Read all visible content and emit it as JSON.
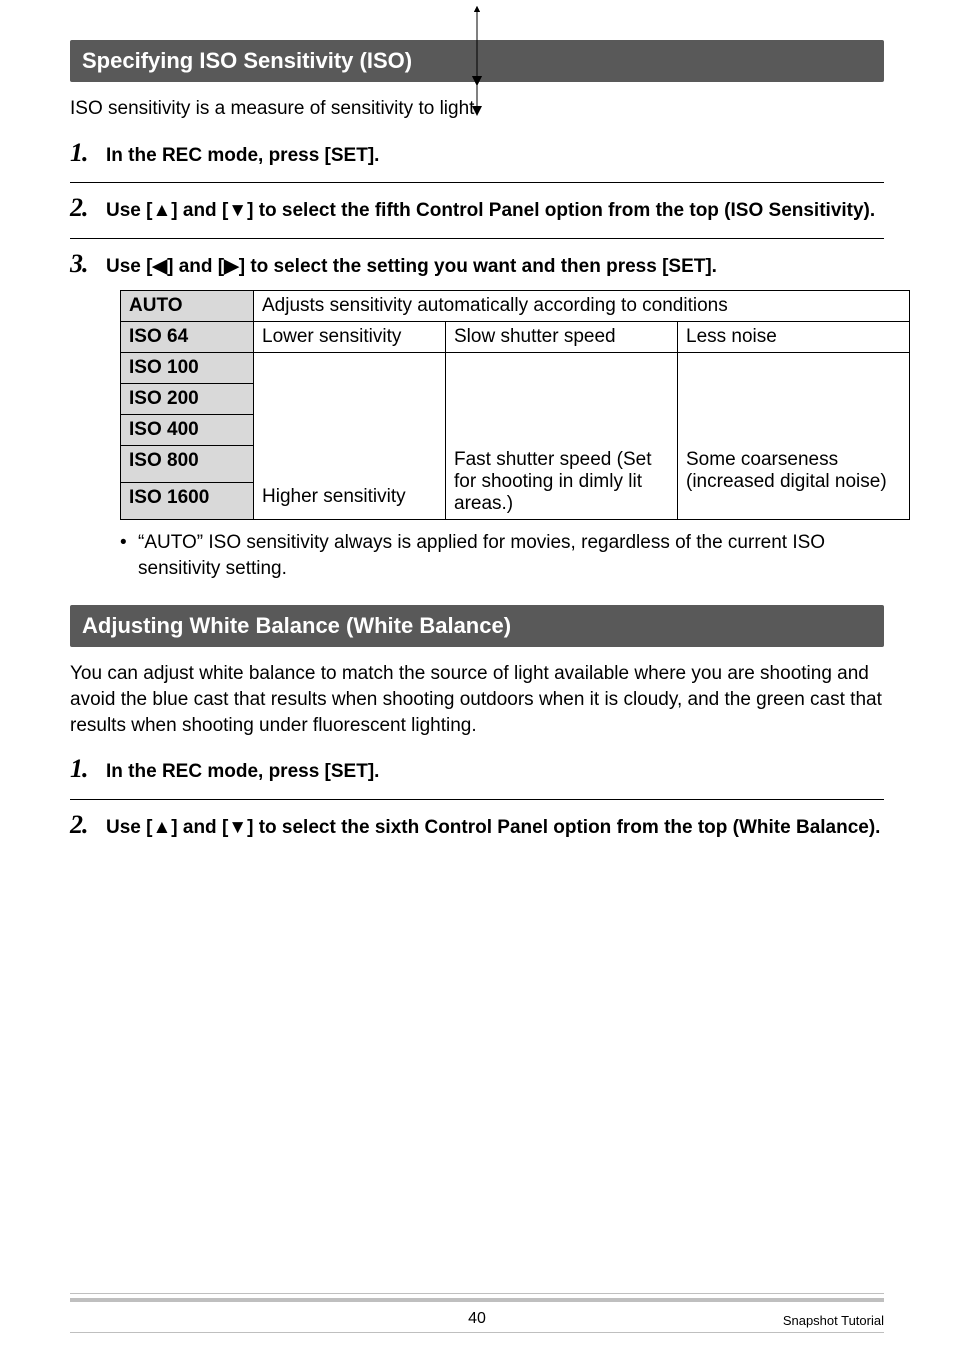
{
  "section1": {
    "title": "Specifying ISO Sensitivity (ISO)",
    "intro": "ISO sensitivity is a measure of sensitivity to light.",
    "steps": {
      "s1": {
        "num": "1.",
        "text": "In the REC mode, press [SET]."
      },
      "s2": {
        "num": "2.",
        "prefix": "Use [",
        "mid": "] and [",
        "suffix": "] to select the fifth Control Panel option from the top (ISO Sensitivity)."
      },
      "s3": {
        "num": "3.",
        "prefix": "Use [",
        "mid": "] and [",
        "suffix": "] to select the setting you want and then press [SET]."
      }
    },
    "table": {
      "rows": [
        "AUTO",
        "ISO 64",
        "ISO 100",
        "ISO 200",
        "ISO 400",
        "ISO 800",
        "ISO 1600"
      ],
      "auto_text": "Adjusts sensitivity automatically according to conditions",
      "col1_top": "Lower sensitivity",
      "col1_bot": "Higher sensitivity",
      "col2_top": "Slow shutter speed",
      "col2_bot": "Fast shutter speed (Set for shooting in dimly lit areas.)",
      "col3_top": "Less noise",
      "col3_bot": "Some coarseness (increased digital noise)"
    },
    "note": "“AUTO” ISO sensitivity always is applied for movies, regardless of the current ISO sensitivity setting."
  },
  "section2": {
    "title": "Adjusting White Balance (White Balance)",
    "intro": "You can adjust white balance to match the source of light available where you are shooting and avoid the blue cast that results when shooting outdoors when it is cloudy, and the green cast that results when shooting under fluorescent lighting.",
    "steps": {
      "s1": {
        "num": "1.",
        "text": "In the REC mode, press [SET]."
      },
      "s2": {
        "num": "2.",
        "prefix": "Use [",
        "mid": "] and [",
        "suffix": "] to select the sixth Control Panel option from the top (White Balance)."
      }
    }
  },
  "footer": {
    "page": "40",
    "section": "Snapshot Tutorial"
  },
  "tri": {
    "up": "▲",
    "down": "▼",
    "left": "◀",
    "right": "▶"
  }
}
